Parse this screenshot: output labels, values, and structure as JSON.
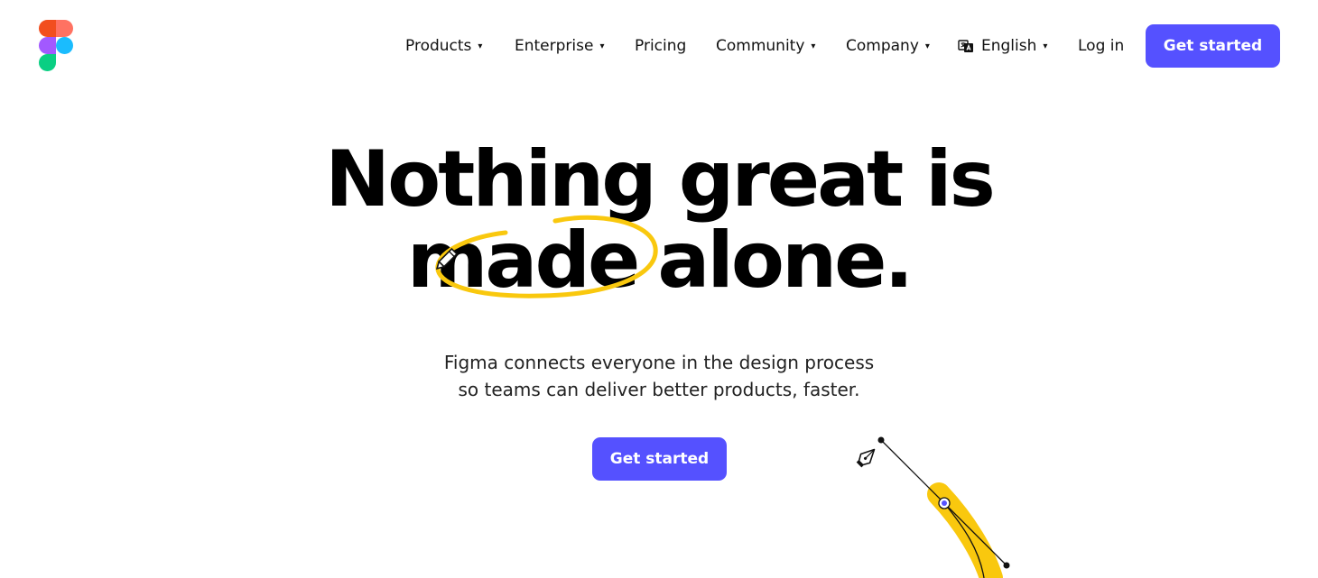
{
  "brand": {
    "logo_icon": "figma-logo-icon",
    "colors": [
      "#f24e1e",
      "#ff7262",
      "#a259ff",
      "#1abcfe",
      "#0acf83"
    ]
  },
  "nav": {
    "items": [
      {
        "label": "Products",
        "dropdown": true
      },
      {
        "label": "Enterprise",
        "dropdown": true
      },
      {
        "label": "Pricing",
        "dropdown": false
      },
      {
        "label": "Community",
        "dropdown": true
      },
      {
        "label": "Company",
        "dropdown": true
      }
    ],
    "language": {
      "label": "English",
      "icon": "language-icon"
    },
    "login_label": "Log in",
    "cta_label": "Get started",
    "caret": "▾"
  },
  "hero": {
    "headline_line1": "Nothing great is",
    "headline_word_circled": "made",
    "headline_rest": "alone.",
    "subtext_line1": "Figma connects everyone in the design process",
    "subtext_line2": "so teams can deliver better products, faster.",
    "cta_label": "Get started",
    "accent_color": "#5551ff",
    "highlight_color": "#f9c80e",
    "decor_icons": [
      "pencil-icon",
      "pen-tool-icon"
    ]
  }
}
